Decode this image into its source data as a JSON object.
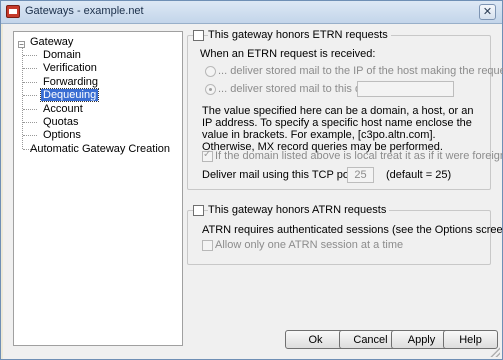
{
  "window": {
    "title": "Gateways - example.net",
    "close": "✕"
  },
  "tree": {
    "root": "Gateway",
    "children": [
      "Domain",
      "Verification",
      "Forwarding",
      "Dequeuing",
      "Account",
      "Quotas",
      "Options"
    ],
    "selected": "Dequeuing",
    "last": "Automatic Gateway Creation"
  },
  "etrn": {
    "honor_label": "This gateway honors ETRN requests",
    "when_label": "When an ETRN request is received:",
    "option_ip": "... deliver stored mail to the IP of the host making the request",
    "option_domain": "... deliver stored mail to this domain",
    "domain_value": "",
    "note": "The value specified here can be a domain, a host, or an IP address.  To specify a specific host name enclose the value in brackets.  For example, [c3po.altn.com].  Otherwise, MX record queries may be performed.",
    "local_foreign_label": "If the domain listed above is local treat it as if it were foreign",
    "port_label": "Deliver mail using this TCP port",
    "port_value": "25",
    "port_default": "(default = 25)"
  },
  "atrn": {
    "honor_label": "This gateway honors ATRN requests",
    "note": "ATRN requires authenticated sessions (see the Options screen).",
    "single_label": "Allow only one ATRN session at a time"
  },
  "buttons": {
    "ok": "Ok",
    "cancel": "Cancel",
    "apply": "Apply",
    "help": "Help"
  },
  "colors": {
    "selection": "#3a6ed3",
    "title_bar": "#c3d5ea"
  }
}
